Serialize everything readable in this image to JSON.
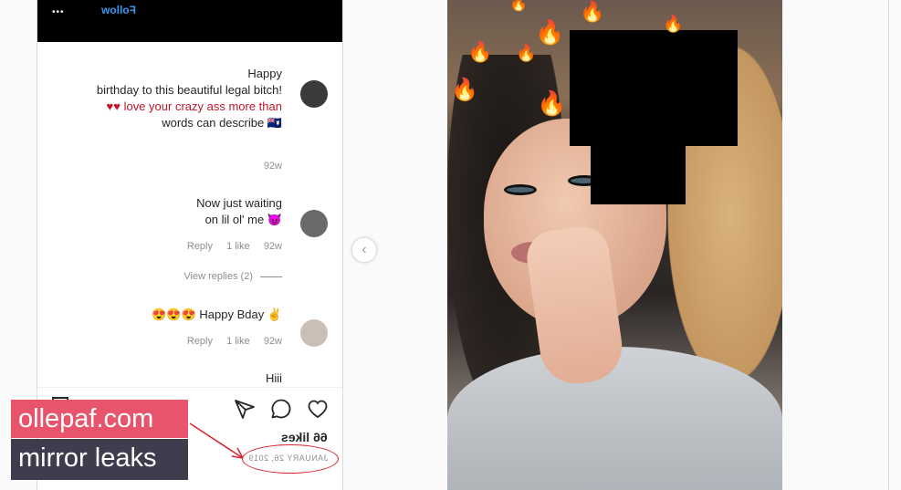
{
  "topbar": {
    "options_label": "•••",
    "follow_label": "Follow"
  },
  "comments": [
    {
      "lines": [
        "Happy",
        "birthday to this beautiful legal bitch!",
        "♥♥ love your crazy ass more than",
        "words can describe 🇦🇮"
      ],
      "meta": {
        "time": "92w"
      }
    },
    {
      "lines": [
        "Now just waiting",
        "on lil ol' me 😈"
      ],
      "meta": {
        "time": "92w",
        "likes": "1 like",
        "reply": "Reply"
      },
      "view_replies": "View replies (2)"
    },
    {
      "lines": [
        "😍😍😍 Happy Bday ✌"
      ],
      "meta": {
        "time": "92w",
        "likes": "1 like",
        "reply": "Reply"
      }
    },
    {
      "lines": [
        "Hiii"
      ]
    }
  ],
  "post": {
    "likes": "66 likes",
    "date": "JANUARY 26, 2019"
  },
  "watermark": {
    "line1": "ollepaf.com",
    "line2": "mirror leaks"
  },
  "nav": {
    "prev_glyph": "‹"
  },
  "photo": {
    "overlays": [
      "🔥",
      "🔥",
      "🔥",
      "🔥",
      "🔥",
      "🔥",
      "🔥",
      "🔥"
    ]
  },
  "colors": {
    "accent": "#3897f0",
    "watermark_pink": "#e8546c",
    "watermark_dark": "#3d3d4e",
    "annotation_red": "#d8232a"
  }
}
